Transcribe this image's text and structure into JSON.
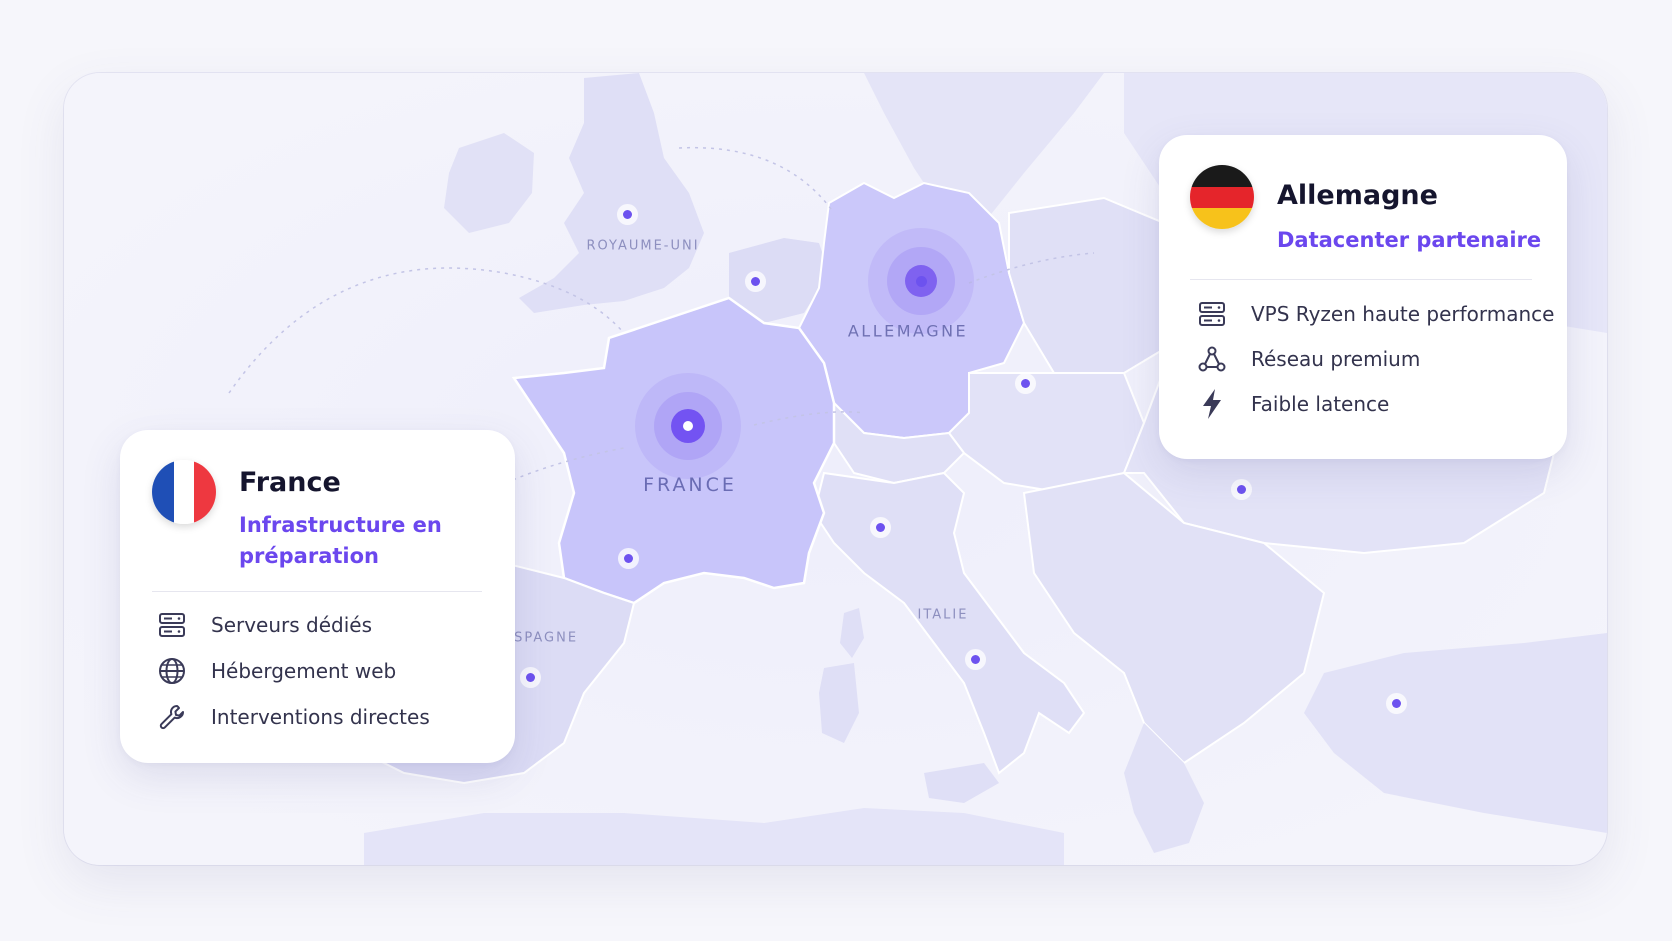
{
  "map": {
    "labels": {
      "uk": "ROYAUME-UNI",
      "france": "FRANCE",
      "germany": "ALLEMAGNE",
      "spain": "ESPAGNE",
      "italy": "ITALIE"
    },
    "colors": {
      "highlight": "#c9c6fa",
      "land": "#e2e2f7",
      "accent": "#6d52ef"
    }
  },
  "cards": {
    "france": {
      "flag": "france-flag",
      "name": "France",
      "subtitle_line1": "Infrastructure en",
      "subtitle_line2": "préparation",
      "features": [
        {
          "icon": "server-icon",
          "label": "Serveurs dédiés"
        },
        {
          "icon": "globe-icon",
          "label": "Hébergement web"
        },
        {
          "icon": "wrench-icon",
          "label": "Interventions directes"
        }
      ]
    },
    "germany": {
      "flag": "germany-flag",
      "name": "Allemagne",
      "subtitle": "Datacenter partenaire",
      "features": [
        {
          "icon": "server-icon",
          "label": "VPS Ryzen haute performance"
        },
        {
          "icon": "network-icon",
          "label": "Réseau premium"
        },
        {
          "icon": "lightning-icon",
          "label": "Faible latence"
        }
      ]
    }
  }
}
